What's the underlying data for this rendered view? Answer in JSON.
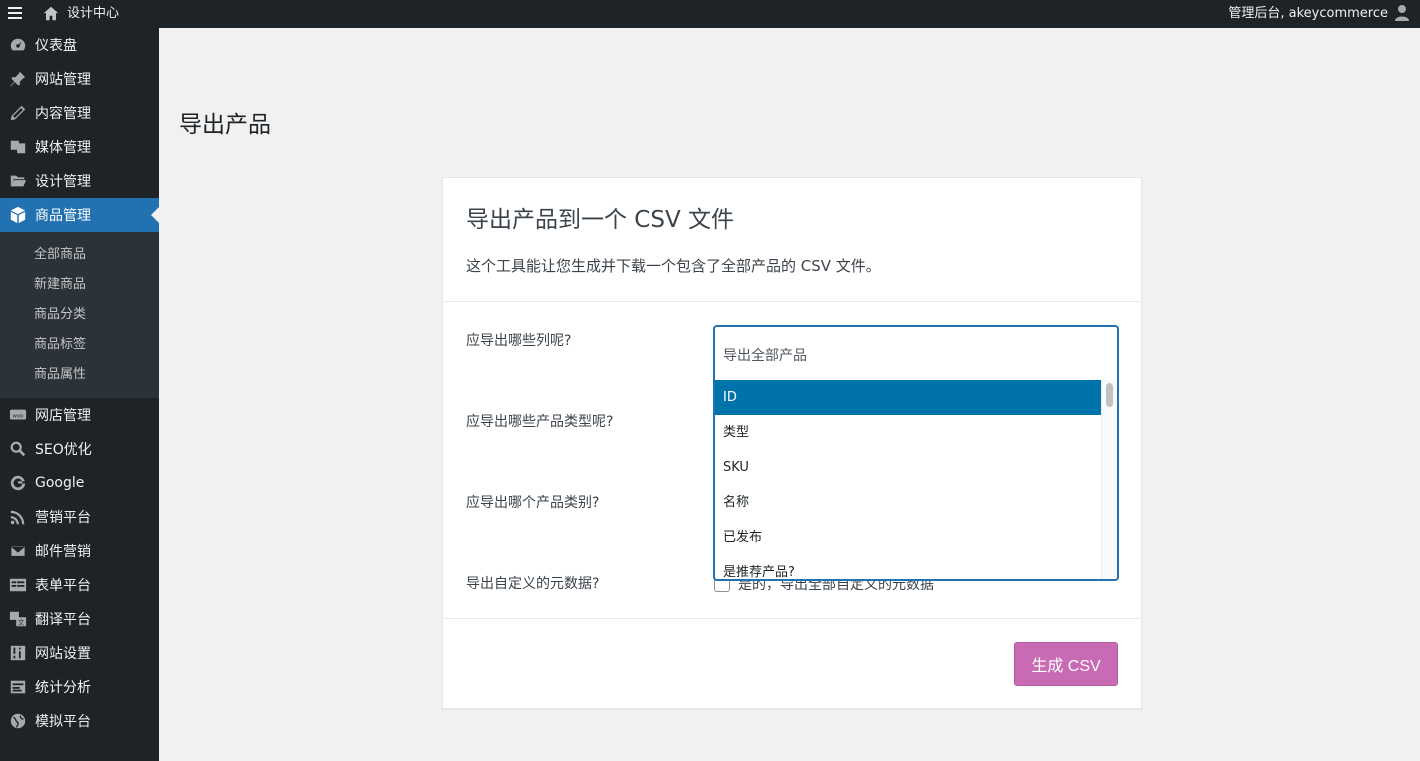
{
  "adminbar": {
    "site_name": "设计中心",
    "account_text": "管理后台, akeycommerce"
  },
  "sidebar": {
    "items": [
      {
        "label": "仪表盘",
        "icon": "dashboard-icon"
      },
      {
        "label": "网站管理",
        "icon": "pin-icon"
      },
      {
        "label": "内容管理",
        "icon": "pencil-icon"
      },
      {
        "label": "媒体管理",
        "icon": "media-icon"
      },
      {
        "label": "设计管理",
        "icon": "folder-icon"
      },
      {
        "label": "商品管理",
        "icon": "box-icon",
        "active": true
      }
    ],
    "submenu": [
      "全部商品",
      "新建商品",
      "商品分类",
      "商品标签",
      "商品属性"
    ],
    "items_after": [
      {
        "label": "网店管理",
        "icon": "woo-icon"
      },
      {
        "label": "SEO优化",
        "icon": "search-icon"
      },
      {
        "label": "Google",
        "icon": "google-icon"
      },
      {
        "label": "营销平台",
        "icon": "rss-icon"
      },
      {
        "label": "邮件营销",
        "icon": "mail-icon"
      },
      {
        "label": "表单平台",
        "icon": "form-icon"
      },
      {
        "label": "翻译平台",
        "icon": "translate-icon"
      },
      {
        "label": "网站设置",
        "icon": "settings-icon"
      },
      {
        "label": "统计分析",
        "icon": "stats-icon"
      },
      {
        "label": "模拟平台",
        "icon": "globe-icon"
      }
    ]
  },
  "page": {
    "title": "导出产品"
  },
  "card": {
    "heading": "导出产品到一个 CSV 文件",
    "description": "这个工具能让您生成并下载一个包含了全部产品的 CSV 文件。",
    "labels": {
      "columns": "应导出哪些列呢?",
      "types": "应导出哪些产品类型呢?",
      "category": "应导出哪个产品类别?",
      "meta": "导出自定义的元数据?"
    },
    "meta_checkbox_label": "是的，导出全部自定义的元数据",
    "select": {
      "placeholder": "导出全部产品",
      "options": [
        "ID",
        "类型",
        "SKU",
        "名称",
        "已发布",
        "是推荐产品?"
      ],
      "highlighted": "ID"
    },
    "generate_button": "生成 CSV"
  },
  "colors": {
    "admin_bar": "#1d2327",
    "sidebar": "#1d2327",
    "active_menu": "#2271b1",
    "highlight_option": "#0073aa",
    "generate_button": "#c86ab4"
  }
}
